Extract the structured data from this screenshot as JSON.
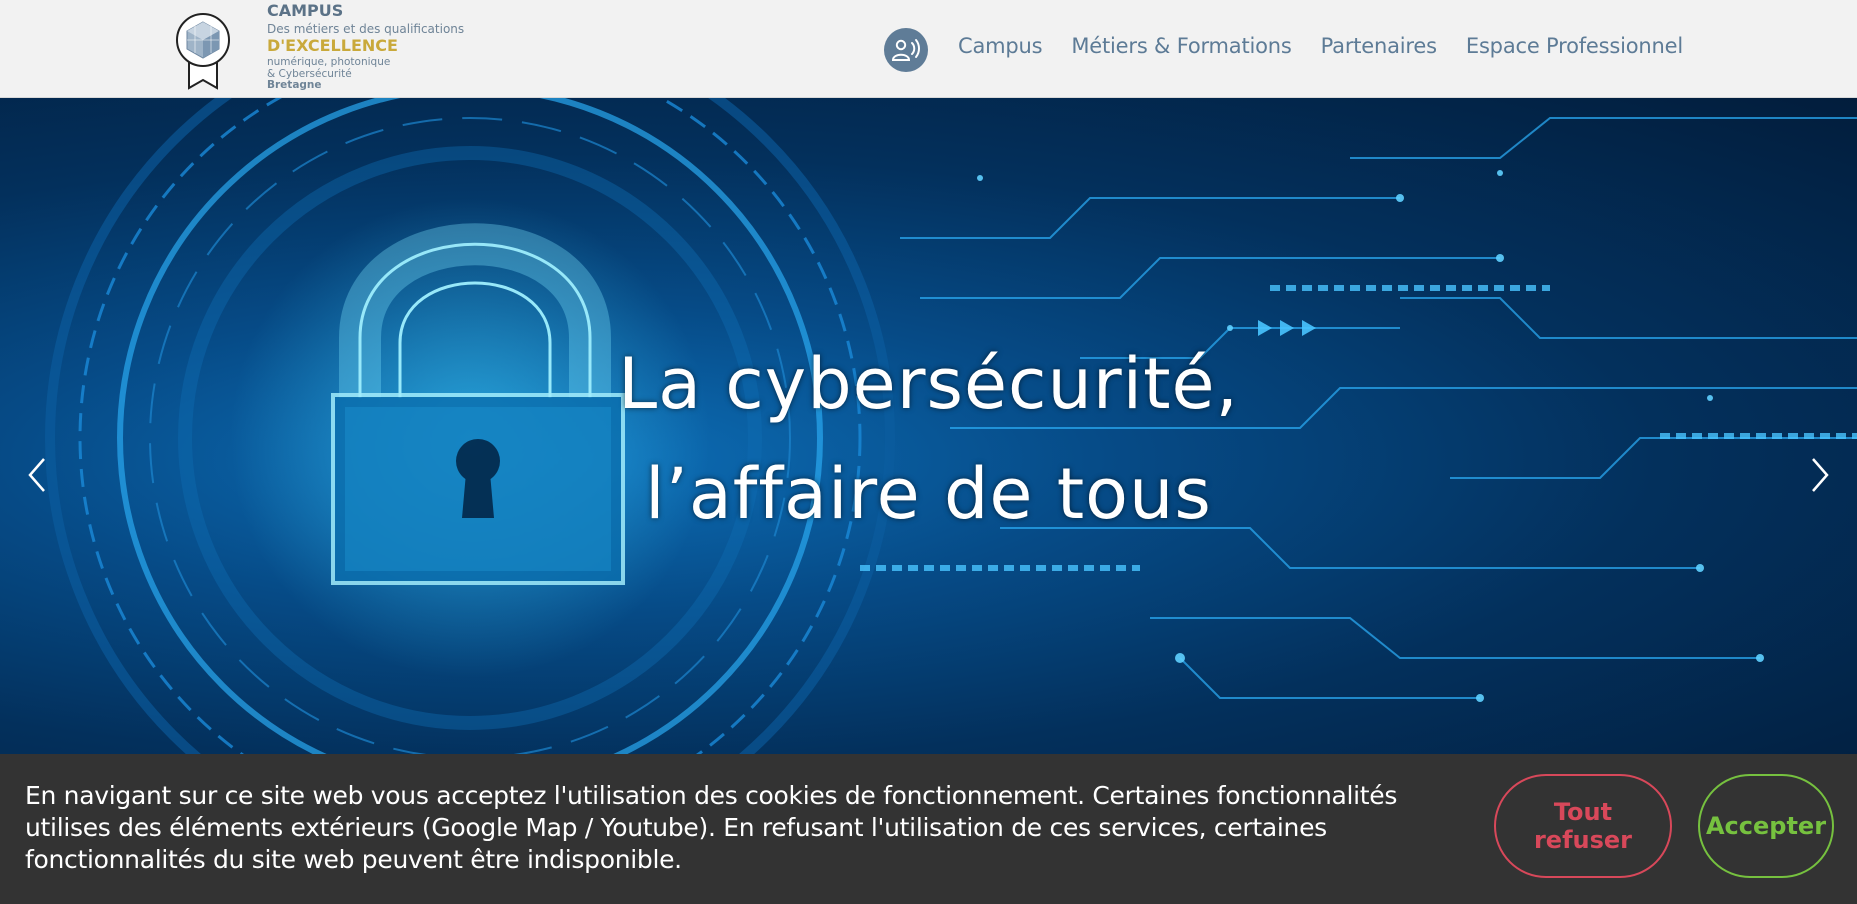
{
  "header": {
    "logo": {
      "campus": "CAMPUS",
      "line1": "Des métiers et des qualifications",
      "excellence": "D'EXCELLENCE",
      "line2": "numérique, photonique",
      "line3": "& Cybersécurité",
      "line4": "Bretagne"
    },
    "accessibility_icon": "accessibility-speech-icon",
    "nav": [
      {
        "label": "Campus"
      },
      {
        "label": "Métiers & Formations"
      },
      {
        "label": "Partenaires"
      },
      {
        "label": "Espace Professionnel"
      }
    ]
  },
  "hero": {
    "title_line1": "La cybersécurité,",
    "title_line2": "l’affaire de tous",
    "prev_icon": "chevron-left-icon",
    "next_icon": "chevron-right-icon"
  },
  "cookie_banner": {
    "text": "En navigant sur ce site web vous acceptez l'utilisation des cookies de fonctionnement. Certaines fonctionnalités utilises des éléments extérieurs (Google Map / Youtube). En refusant l'utilisation de ces services, certaines fonctionnalités du site web peuvent être indisponible.",
    "refuse_label": "Tout refuser",
    "accept_label": "Accepter"
  },
  "colors": {
    "nav_text": "#5d7b96",
    "logo_gold": "#c9a93b",
    "refuse": "#d8485a",
    "accept": "#76c13f",
    "banner_bg": "#333333"
  }
}
